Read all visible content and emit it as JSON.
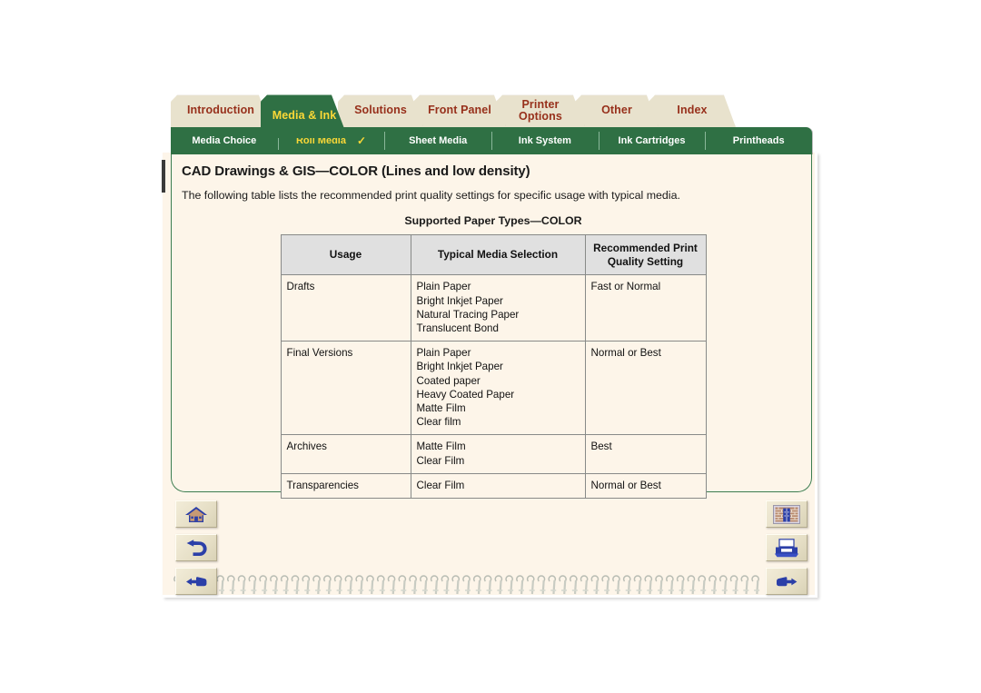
{
  "nav": {
    "main_tabs": [
      {
        "label": "Introduction",
        "active": false
      },
      {
        "label": "Media & Ink",
        "active": true
      },
      {
        "label": "Solutions",
        "active": false
      },
      {
        "label": "Front Panel",
        "active": false
      },
      {
        "label": "Printer Options",
        "active": false,
        "line1": "Printer",
        "line2": "Options"
      },
      {
        "label": "Other",
        "active": false
      },
      {
        "label": "Index",
        "active": false
      }
    ],
    "sub_tabs": [
      {
        "label": "Media Choice",
        "active": false,
        "check": ""
      },
      {
        "label": "Roll Media",
        "active": true,
        "check": "✓"
      },
      {
        "label": "Sheet Media",
        "active": false,
        "check": ""
      },
      {
        "label": "Ink System",
        "active": false,
        "check": ""
      },
      {
        "label": "Ink Cartridges",
        "active": false,
        "check": ""
      },
      {
        "label": "Printheads",
        "active": false,
        "check": ""
      }
    ]
  },
  "page": {
    "title": "CAD Drawings & GIS—COLOR (Lines and low density)",
    "intro": "The following table lists the recommended print quality settings for specific usage with typical media.",
    "table_caption": "Supported Paper Types—COLOR"
  },
  "table": {
    "headers": [
      "Usage",
      "Typical Media Selection",
      "Recommended Print Quality Setting"
    ],
    "header_lines": [
      [
        "Usage"
      ],
      [
        "Typical Media Selection"
      ],
      [
        "Recommended Print",
        "Quality Setting"
      ]
    ],
    "rows": [
      {
        "usage": "Drafts",
        "media": [
          "Plain Paper",
          "Bright Inkjet Paper",
          "Natural Tracing Paper",
          "Translucent Bond"
        ],
        "quality": "Fast or Normal"
      },
      {
        "usage": "Final Versions",
        "media": [
          "Plain Paper",
          "Bright Inkjet Paper",
          "Coated paper",
          "Heavy Coated Paper",
          "Matte Film",
          "Clear film"
        ],
        "quality": "Normal or Best"
      },
      {
        "usage": "Archives",
        "media": [
          "Matte Film",
          "Clear Film"
        ],
        "quality": "Best"
      },
      {
        "usage": "Transparencies",
        "media": [
          "Clear Film"
        ],
        "quality": "Normal or Best"
      }
    ]
  },
  "buttons": {
    "home": "home-icon",
    "back": "back-arrow-icon",
    "previous": "hand-pointing-left-icon",
    "index": "bookstore-index-icon",
    "print": "printer-icon",
    "next": "hand-pointing-right-icon"
  },
  "colors": {
    "tab_active_bg": "#2f7044",
    "tab_active_text": "#fbd837",
    "tab_inactive_bg": "#e8e2cd",
    "tab_inactive_text": "#97301b",
    "page_bg": "#fdf5e9",
    "frame_border": "#3c7d50",
    "table_header_bg": "#e0e0e0",
    "icon_blue": "#2b3fa8"
  }
}
